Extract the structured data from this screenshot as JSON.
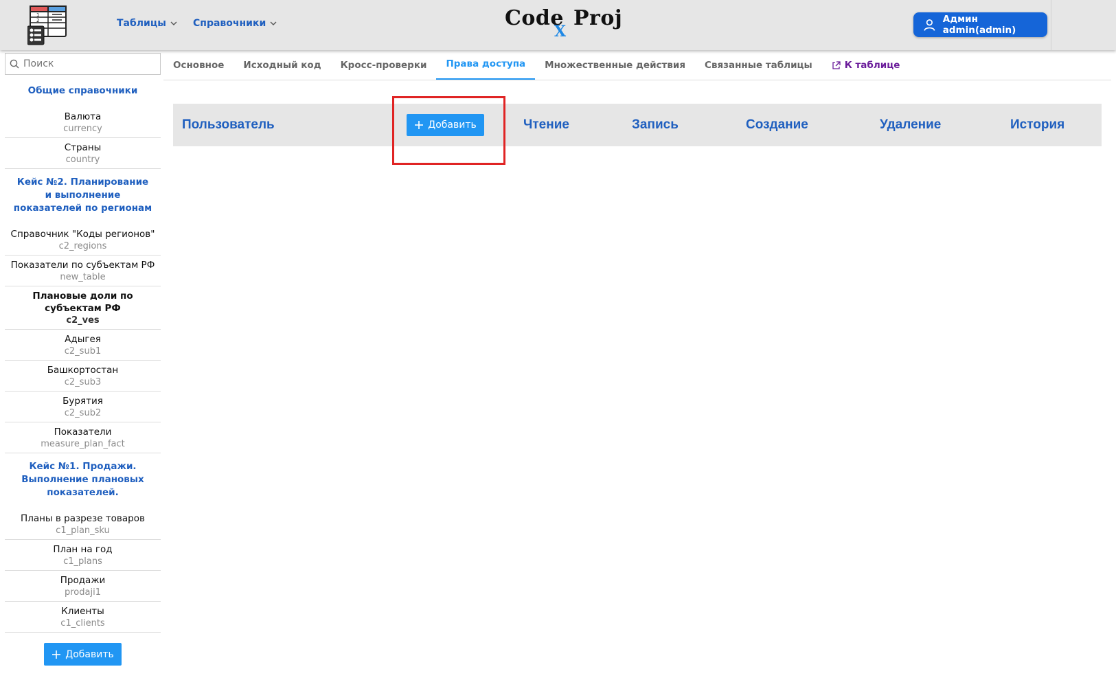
{
  "header": {
    "nav": [
      {
        "label": "Таблицы"
      },
      {
        "label": "Справочники"
      }
    ],
    "brand": {
      "left": "Code",
      "x": "X",
      "right": "Proj"
    },
    "user_label": "Админ admin(admin)"
  },
  "sidebar": {
    "search_placeholder": "Поиск",
    "groups": [
      {
        "title": "Общие справочники",
        "items": [
          {
            "title": "Валюта",
            "sub": "currency"
          },
          {
            "title": "Страны",
            "sub": "country"
          }
        ]
      },
      {
        "title": "Кейс №2. Планирование и выполнение показателей по регионам",
        "items": [
          {
            "title": "Справочник \"Коды регионов\"",
            "sub": "c2_regions"
          },
          {
            "title": "Показатели по субъектам РФ",
            "sub": "new_table"
          },
          {
            "title": "Плановые доли по субъектам РФ",
            "sub": "c2_ves",
            "active": true
          },
          {
            "title": "Адыгея",
            "sub": "c2_sub1"
          },
          {
            "title": "Башкортостан",
            "sub": "c2_sub3"
          },
          {
            "title": "Бурятия",
            "sub": "c2_sub2"
          },
          {
            "title": "Показатели",
            "sub": "measure_plan_fact"
          }
        ]
      },
      {
        "title": "Кейс №1. Продажи. Выполнение плановых показателей.",
        "items": [
          {
            "title": "Планы в разрезе товаров",
            "sub": "c1_plan_sku"
          },
          {
            "title": "План на год",
            "sub": "c1_plans"
          },
          {
            "title": "Продажи",
            "sub": "prodaji1"
          },
          {
            "title": "Клиенты",
            "sub": "c1_clients"
          }
        ]
      }
    ],
    "add_label": "Добавить"
  },
  "tabs": [
    {
      "label": "Основное"
    },
    {
      "label": "Исходный код"
    },
    {
      "label": "Кросс-проверки"
    },
    {
      "label": "Права доступа",
      "active": true
    },
    {
      "label": "Множественные действия"
    },
    {
      "label": "Связанные таблицы"
    },
    {
      "label": "К таблице",
      "link": true
    }
  ],
  "permissions": {
    "columns": {
      "user": "Пользователь",
      "read": "Чтение",
      "write": "Запись",
      "create": "Создание",
      "delete": "Удаление",
      "history": "История"
    },
    "add_label": "Добавить"
  },
  "colors": {
    "accent": "#2196f3",
    "brand_blue": "#1f5fbf",
    "highlight": "#e02424",
    "link": "#6a1b9a"
  }
}
